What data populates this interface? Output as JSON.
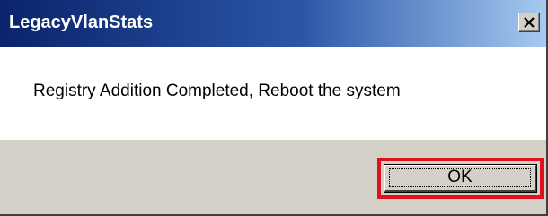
{
  "window": {
    "title": "LegacyVlanStats",
    "close_icon": "close-icon"
  },
  "message": {
    "text": "Registry Addition Completed, Reboot the system"
  },
  "buttons": {
    "ok_label": "OK"
  },
  "colors": {
    "titlebar_start": "#0a246a",
    "titlebar_end": "#a6caf0",
    "dialog_face": "#d4d0c8",
    "highlight_border": "#e0101c"
  }
}
